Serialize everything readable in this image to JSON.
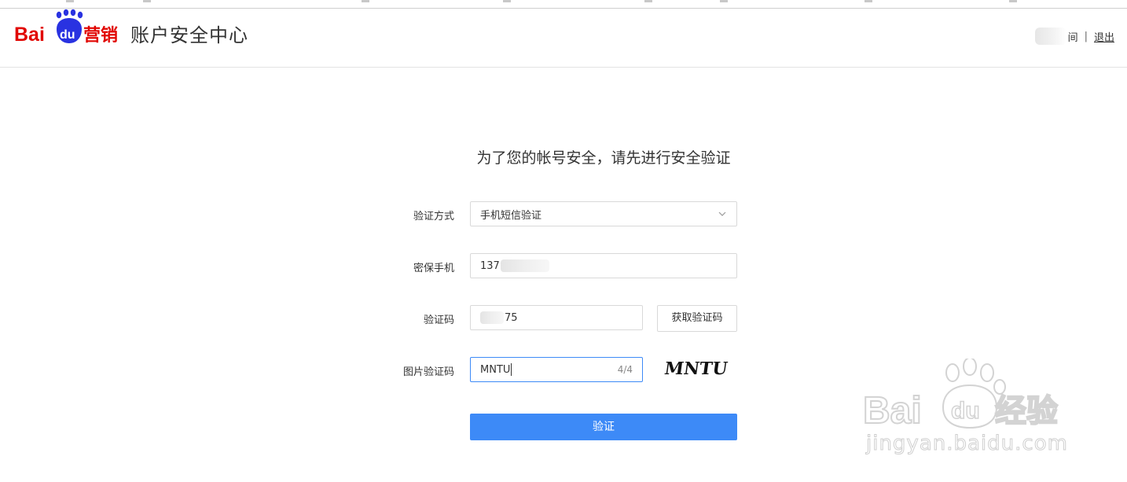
{
  "header": {
    "logo_brand": "Bai",
    "logo_du": "du",
    "logo_suffix": "营销",
    "title": "账户安全中心",
    "user_suffix": "间",
    "separator": "|",
    "logout_label": "退出"
  },
  "page": {
    "title": "为了您的帐号安全，请先进行安全验证"
  },
  "form": {
    "method": {
      "label": "验证方式",
      "value": "手机短信验证"
    },
    "phone": {
      "label": "密保手机",
      "value_prefix": "137"
    },
    "code": {
      "label": "验证码",
      "value_suffix": "75",
      "button_label": "获取验证码"
    },
    "captcha": {
      "label": "图片验证码",
      "value": "MNTU",
      "count": "4/4",
      "image_text": "MNTU"
    },
    "submit_label": "验证"
  },
  "watermark": {
    "brand": "Bai",
    "du": "du",
    "suffix": "经验",
    "url": "jingyan.baidu.com"
  },
  "colors": {
    "baidu_red": "#e10602",
    "baidu_blue": "#2932e1",
    "primary_button": "#3d8af7",
    "focus_border": "#3d8af7"
  }
}
